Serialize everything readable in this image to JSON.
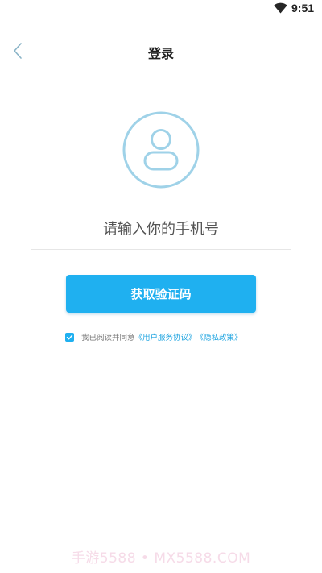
{
  "status_bar": {
    "time": "9:51",
    "wifi_icon": "wifi-icon"
  },
  "header": {
    "title": "登录",
    "back_icon": "chevron-left-icon"
  },
  "avatar": {
    "icon": "user-avatar-icon",
    "color": "#9fd2e8"
  },
  "form": {
    "phone_placeholder": "请输入你的手机号",
    "phone_value": "",
    "code_button_label": "获取验证码"
  },
  "agreement": {
    "checked": true,
    "prefix": "我已阅读并同意",
    "user_agreement": "《用户服务协议》",
    "privacy_policy": "《隐私政策》"
  },
  "watermark": {
    "text": "手游5588 • MX5588.COM"
  },
  "colors": {
    "accent": "#1fb0f0",
    "link": "#1ba3e0",
    "avatar_outline": "#9fd2e8"
  }
}
